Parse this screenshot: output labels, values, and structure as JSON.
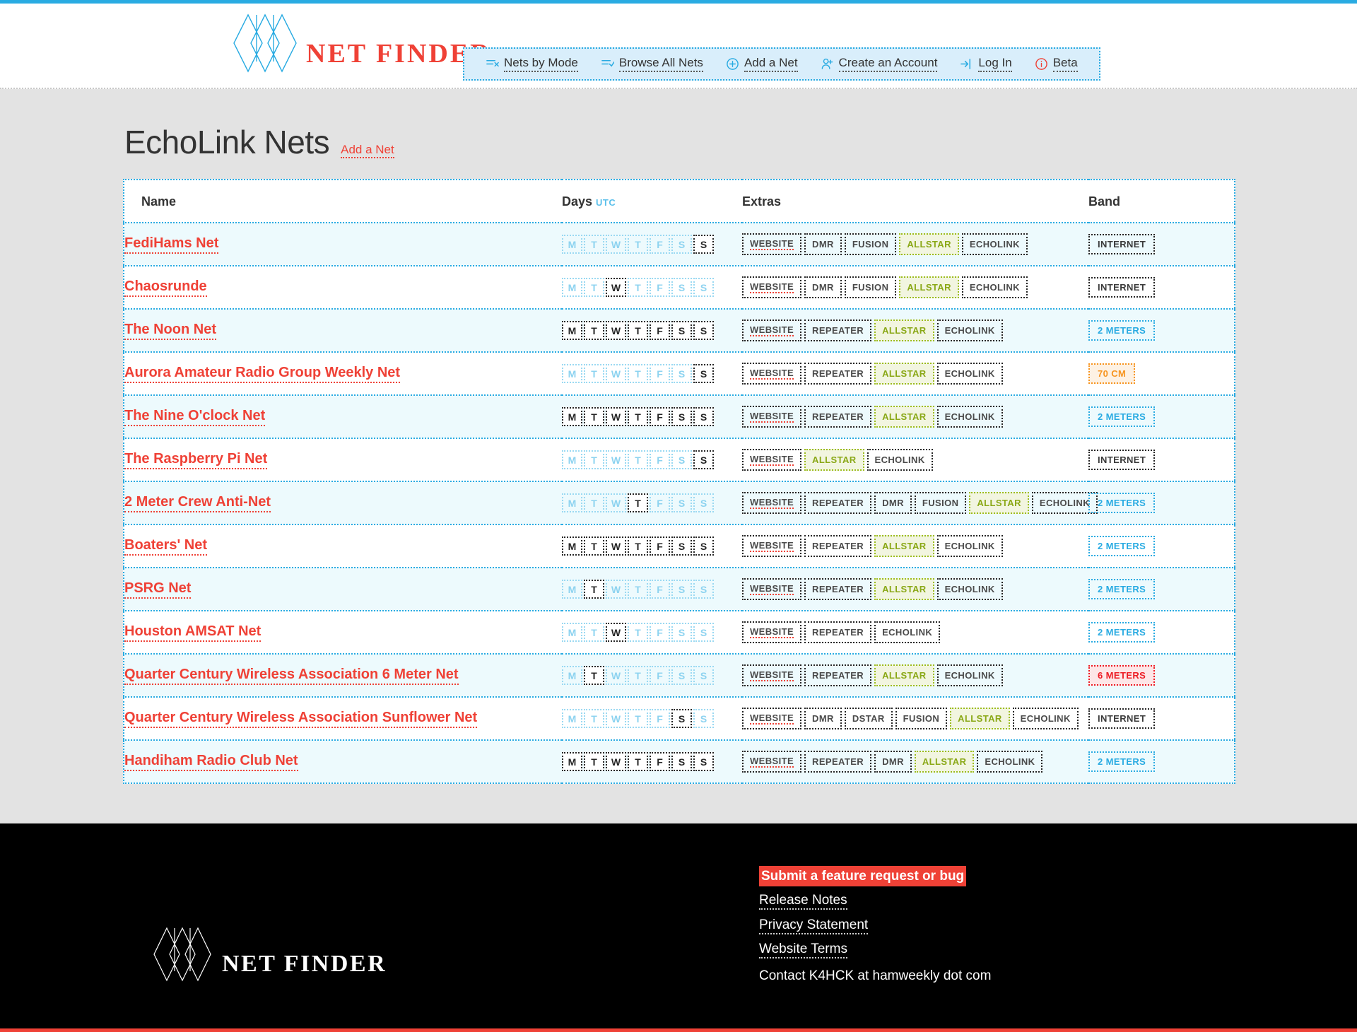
{
  "brand": {
    "word": "NET FINDER",
    "logo_color": "#29abe2",
    "word_color": "#ef4136"
  },
  "nav": {
    "items": [
      {
        "label": "Nets by Mode",
        "icon": "filter-list-icon"
      },
      {
        "label": "Browse All Nets",
        "icon": "list-check-icon"
      },
      {
        "label": "Add a Net",
        "icon": "plus-circle-icon"
      },
      {
        "label": "Create an Account",
        "icon": "user-plus-icon"
      },
      {
        "label": "Log In",
        "icon": "login-arrow-icon"
      },
      {
        "label": "Beta",
        "icon": "info-circle-icon"
      }
    ]
  },
  "page": {
    "title": "EchoLink Nets",
    "add_link": "Add a Net"
  },
  "table": {
    "headers": {
      "name": "Name",
      "days": "Days",
      "days_tz": "UTC",
      "extras": "Extras",
      "band": "Band"
    },
    "day_letters": [
      "M",
      "T",
      "W",
      "T",
      "F",
      "S",
      "S"
    ],
    "rows": [
      {
        "name": "FediHams Net",
        "days": [
          false,
          false,
          false,
          false,
          false,
          false,
          true
        ],
        "extras": [
          "WEBSITE",
          "DMR",
          "FUSION",
          "ALLSTAR",
          "ECHOLINK"
        ],
        "band": "INTERNET"
      },
      {
        "name": "Chaosrunde",
        "days": [
          false,
          false,
          true,
          false,
          false,
          false,
          false
        ],
        "extras": [
          "WEBSITE",
          "DMR",
          "FUSION",
          "ALLSTAR",
          "ECHOLINK"
        ],
        "band": "INTERNET"
      },
      {
        "name": "The Noon Net",
        "days": [
          true,
          true,
          true,
          true,
          true,
          true,
          true
        ],
        "extras": [
          "WEBSITE",
          "REPEATER",
          "ALLSTAR",
          "ECHOLINK"
        ],
        "band": "2 METERS"
      },
      {
        "name": "Aurora Amateur Radio Group Weekly Net",
        "days": [
          false,
          false,
          false,
          false,
          false,
          false,
          true
        ],
        "extras": [
          "WEBSITE",
          "REPEATER",
          "ALLSTAR",
          "ECHOLINK"
        ],
        "band": "70 CM"
      },
      {
        "name": "The Nine O'clock Net",
        "days": [
          true,
          true,
          true,
          true,
          true,
          true,
          true
        ],
        "extras": [
          "WEBSITE",
          "REPEATER",
          "ALLSTAR",
          "ECHOLINK"
        ],
        "band": "2 METERS"
      },
      {
        "name": "The Raspberry Pi Net",
        "days": [
          false,
          false,
          false,
          false,
          false,
          false,
          true
        ],
        "extras": [
          "WEBSITE",
          "ALLSTAR",
          "ECHOLINK"
        ],
        "band": "INTERNET"
      },
      {
        "name": "2 Meter Crew Anti-Net",
        "days": [
          false,
          false,
          false,
          true,
          false,
          false,
          false
        ],
        "extras": [
          "WEBSITE",
          "REPEATER",
          "DMR",
          "FUSION",
          "ALLSTAR",
          "ECHOLINK"
        ],
        "band": "2 METERS"
      },
      {
        "name": "Boaters' Net",
        "days": [
          true,
          true,
          true,
          true,
          true,
          true,
          true
        ],
        "extras": [
          "WEBSITE",
          "REPEATER",
          "ALLSTAR",
          "ECHOLINK"
        ],
        "band": "2 METERS"
      },
      {
        "name": "PSRG Net",
        "days": [
          false,
          true,
          false,
          false,
          false,
          false,
          false
        ],
        "extras": [
          "WEBSITE",
          "REPEATER",
          "ALLSTAR",
          "ECHOLINK"
        ],
        "band": "2 METERS"
      },
      {
        "name": "Houston AMSAT Net",
        "days": [
          false,
          false,
          true,
          false,
          false,
          false,
          false
        ],
        "extras": [
          "WEBSITE",
          "REPEATER",
          "ECHOLINK"
        ],
        "band": "2 METERS"
      },
      {
        "name": "Quarter Century Wireless Association 6 Meter Net",
        "days": [
          false,
          true,
          false,
          false,
          false,
          false,
          false
        ],
        "extras": [
          "WEBSITE",
          "REPEATER",
          "ALLSTAR",
          "ECHOLINK"
        ],
        "band": "6 METERS"
      },
      {
        "name": "Quarter Century Wireless Association Sunflower Net",
        "days": [
          false,
          false,
          false,
          false,
          false,
          true,
          false
        ],
        "extras": [
          "WEBSITE",
          "DMR",
          "DSTAR",
          "FUSION",
          "ALLSTAR",
          "ECHOLINK"
        ],
        "band": "INTERNET"
      },
      {
        "name": "Handiham Radio Club Net",
        "days": [
          true,
          true,
          true,
          true,
          true,
          true,
          true
        ],
        "extras": [
          "WEBSITE",
          "REPEATER",
          "DMR",
          "ALLSTAR",
          "ECHOLINK"
        ],
        "band": "2 METERS"
      }
    ]
  },
  "footer": {
    "brand_word": "NET FINDER",
    "links": [
      {
        "label": "Submit a feature request or bug",
        "highlight": true
      },
      {
        "label": "Release Notes",
        "highlight": false
      },
      {
        "label": "Privacy Statement",
        "highlight": false
      },
      {
        "label": "Website Terms",
        "highlight": false
      }
    ],
    "contact": "Contact K4HCK at hamweekly dot com"
  },
  "colors": {
    "accent_blue": "#29abe2",
    "accent_red": "#ef4136",
    "allstar_green": "#8aa816",
    "band_orange": "#f7941e",
    "band_red": "#ed1c24"
  }
}
